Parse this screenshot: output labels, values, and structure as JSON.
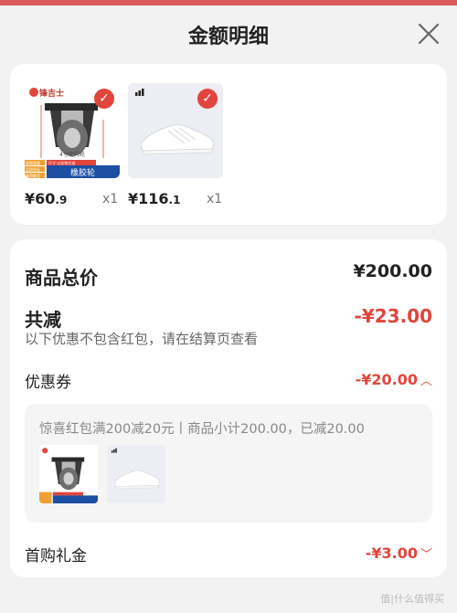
{
  "header": {
    "title": "金额明细"
  },
  "products": [
    {
      "price_main": "¥60",
      "price_dec": ".9",
      "qty": "x1",
      "brand_text": "锋吉士",
      "caption": "4寸定向轮",
      "label": "橡胶轮",
      "tag1": "高稳承重",
      "tag2": "品质保证",
      "tag3": "顺滑静音",
      "spec": "尺寸:以实物为准"
    },
    {
      "price_main": "¥116",
      "price_dec": ".1",
      "qty": "x1"
    }
  ],
  "summary": {
    "total_label": "商品总价",
    "total_value": "¥200.00",
    "reduce_label": "共减",
    "reduce_value": "-¥23.00",
    "note": "以下优惠不包含红包，请在结算页查看",
    "coupon_label": "优惠券",
    "coupon_value": "-¥20.00",
    "coupon_detail": "惊喜红包满200减20元丨商品小计200.00，已减20.00",
    "gift_label": "首购礼金",
    "gift_value": "-¥3.00"
  },
  "watermark": "值|什么值得买",
  "colors": {
    "accent": "#e2453c",
    "sheet_bg": "#f2f2f2",
    "card_bg": "#ffffff"
  },
  "icons": [
    "close-icon",
    "check-icon",
    "chevron-up-icon",
    "chevron-down-icon",
    "adidas-logo-icon"
  ]
}
